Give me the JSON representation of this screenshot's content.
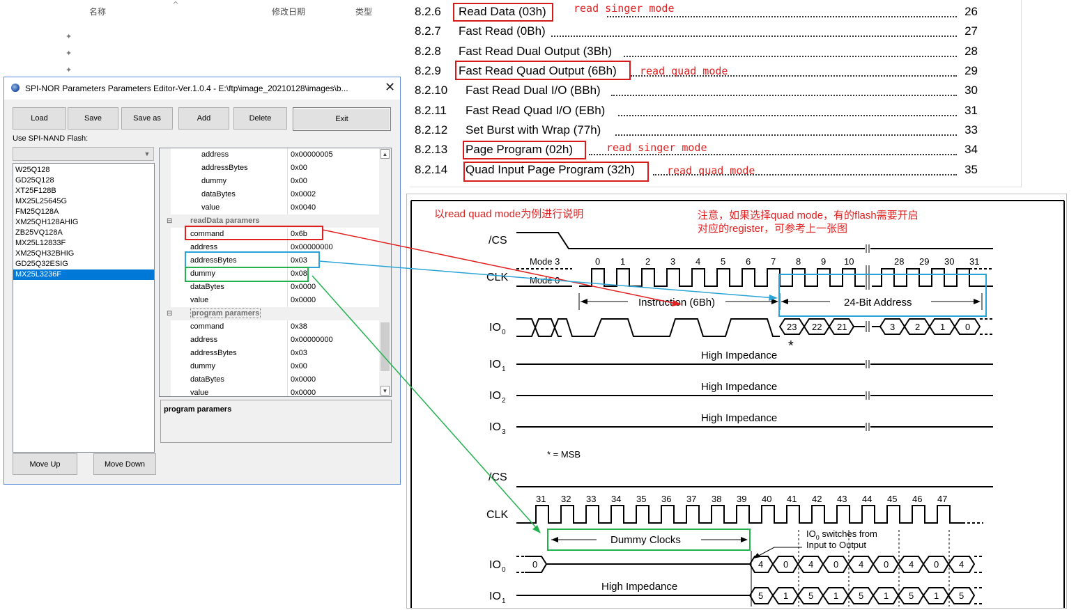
{
  "explorer": {
    "col_name": "名称",
    "col_date": "修改日期",
    "col_type": "类型",
    "pin_icons": [
      "pin-icon",
      "pin-icon",
      "pin-icon"
    ]
  },
  "editor": {
    "title": "SPI-NOR Parameters Parameters Editor-Ver.1.0.4 - E:\\ftp\\image_20210128\\images\\b...",
    "close_symbol": "✕",
    "buttons": {
      "load": "Load",
      "save": "Save",
      "save_as": "Save as",
      "add": "Add",
      "delete": "Delete",
      "exit": "Exit",
      "move_up": "Move Up",
      "move_down": "Move Down"
    },
    "nand_label": "Use SPI-NAND Flash:",
    "nand_value": "",
    "chips": [
      "W25Q128",
      "GD25Q128",
      "XT25F128B",
      "MX25L25645G",
      "FM25Q128A",
      "XM25QH128AHIG",
      "ZB25VQ128A",
      "MX25L12833F",
      "XM25QH32BHIG",
      "GD25Q32ESIG",
      "MX25L3236F"
    ],
    "selected_chip": "MX25L3236F",
    "grid": {
      "top_params": [
        {
          "key": "address",
          "value": "0x00000005"
        },
        {
          "key": "addressBytes",
          "value": "0x00"
        },
        {
          "key": "dummy",
          "value": "0x00"
        },
        {
          "key": "dataBytes",
          "value": "0x0002"
        },
        {
          "key": "value",
          "value": "0x0040"
        }
      ],
      "read_category": "readData paramers",
      "read_params": [
        {
          "key": "command",
          "value": "0x6b"
        },
        {
          "key": "address",
          "value": "0x00000000"
        },
        {
          "key": "addressBytes",
          "value": "0x03"
        },
        {
          "key": "dummy",
          "value": "0x08"
        },
        {
          "key": "dataBytes",
          "value": "0x0000"
        },
        {
          "key": "value",
          "value": "0x0000"
        }
      ],
      "program_category": "program paramers",
      "program_params": [
        {
          "key": "command",
          "value": "0x38"
        },
        {
          "key": "address",
          "value": "0x00000000"
        },
        {
          "key": "addressBytes",
          "value": "0x03"
        },
        {
          "key": "dummy",
          "value": "0x00"
        },
        {
          "key": "dataBytes",
          "value": "0x0000"
        },
        {
          "key": "value",
          "value": "0x0000"
        }
      ]
    },
    "description_title": "program paramers"
  },
  "toc": [
    {
      "num": "8.2.6",
      "title": "Read Data (03h)",
      "page": "26"
    },
    {
      "num": "8.2.7",
      "title": "Fast Read (0Bh)",
      "page": "27"
    },
    {
      "num": "8.2.8",
      "title": "Fast Read Dual Output (3Bh)",
      "page": "28"
    },
    {
      "num": "8.2.9",
      "title": "Fast Read Quad Output (6Bh)",
      "page": "29"
    },
    {
      "num": "8.2.10",
      "title": "Fast Read Dual I/O (BBh)",
      "page": "30"
    },
    {
      "num": "8.2.11",
      "title": "Fast Read Quad I/O (EBh)",
      "page": "31"
    },
    {
      "num": "8.2.12",
      "title": "Set Burst with Wrap (77h)",
      "page": "33"
    },
    {
      "num": "8.2.13",
      "title": "Page Program (02h)",
      "page": "34"
    },
    {
      "num": "8.2.14",
      "title": "Quad Input Page Program (32h)",
      "page": "35"
    }
  ],
  "toc_annotations": {
    "a1": "read singer mode",
    "a2": "read quad mode",
    "a3": "read singer mode",
    "a4": "read quad mode"
  },
  "timing": {
    "note_left": "以read quad mode为例进行说明",
    "note_right_1": "注意，如果选择quad mode，有的flash需要开启",
    "note_right_2": "对应的register，可参考上一张图",
    "cs_label": "/CS",
    "clk_label": "CLK",
    "io0_label": "IO",
    "io1_label": "IO",
    "io2_label": "IO",
    "io3_label": "IO",
    "io0_sub": "0",
    "io1_sub": "1",
    "io2_sub": "2",
    "io3_sub": "3",
    "mode3": "Mode 3",
    "mode0": "Mode 0",
    "clk_numbers_top": [
      "0",
      "1",
      "2",
      "3",
      "4",
      "5",
      "6",
      "7",
      "8",
      "9",
      "10",
      "28",
      "29",
      "30",
      "31"
    ],
    "instruction_label": "Instruction (6Bh)",
    "address_label": "24-Bit Address",
    "addr_bits_left": [
      "23",
      "22",
      "21"
    ],
    "addr_bits_right": [
      "3",
      "2",
      "1",
      "0"
    ],
    "msb_star": "*",
    "high_z": "High Impedance",
    "msb_legend": "* = MSB",
    "clk_numbers_bottom": [
      "31",
      "32",
      "33",
      "34",
      "35",
      "36",
      "37",
      "38",
      "39",
      "40",
      "41",
      "42",
      "43",
      "44",
      "45",
      "46",
      "47"
    ],
    "dummy_clocks": "Dummy Clocks",
    "switch_note_1": "IO",
    "switch_note_sub": "0",
    "switch_note_1b": " switches from",
    "switch_note_2": "Input to Output",
    "io0_bottom_start": "0",
    "io0_bottom_bits": [
      "4",
      "0",
      "4",
      "0",
      "4",
      "0",
      "4",
      "0",
      "4"
    ],
    "io1_bottom_bits": [
      "5",
      "1",
      "5",
      "1",
      "5",
      "1",
      "5",
      "1",
      "5"
    ]
  },
  "colors": {
    "red": "#e02020",
    "blue": "#2aa4d6",
    "green": "#22b14c",
    "selection": "#0078d7"
  }
}
